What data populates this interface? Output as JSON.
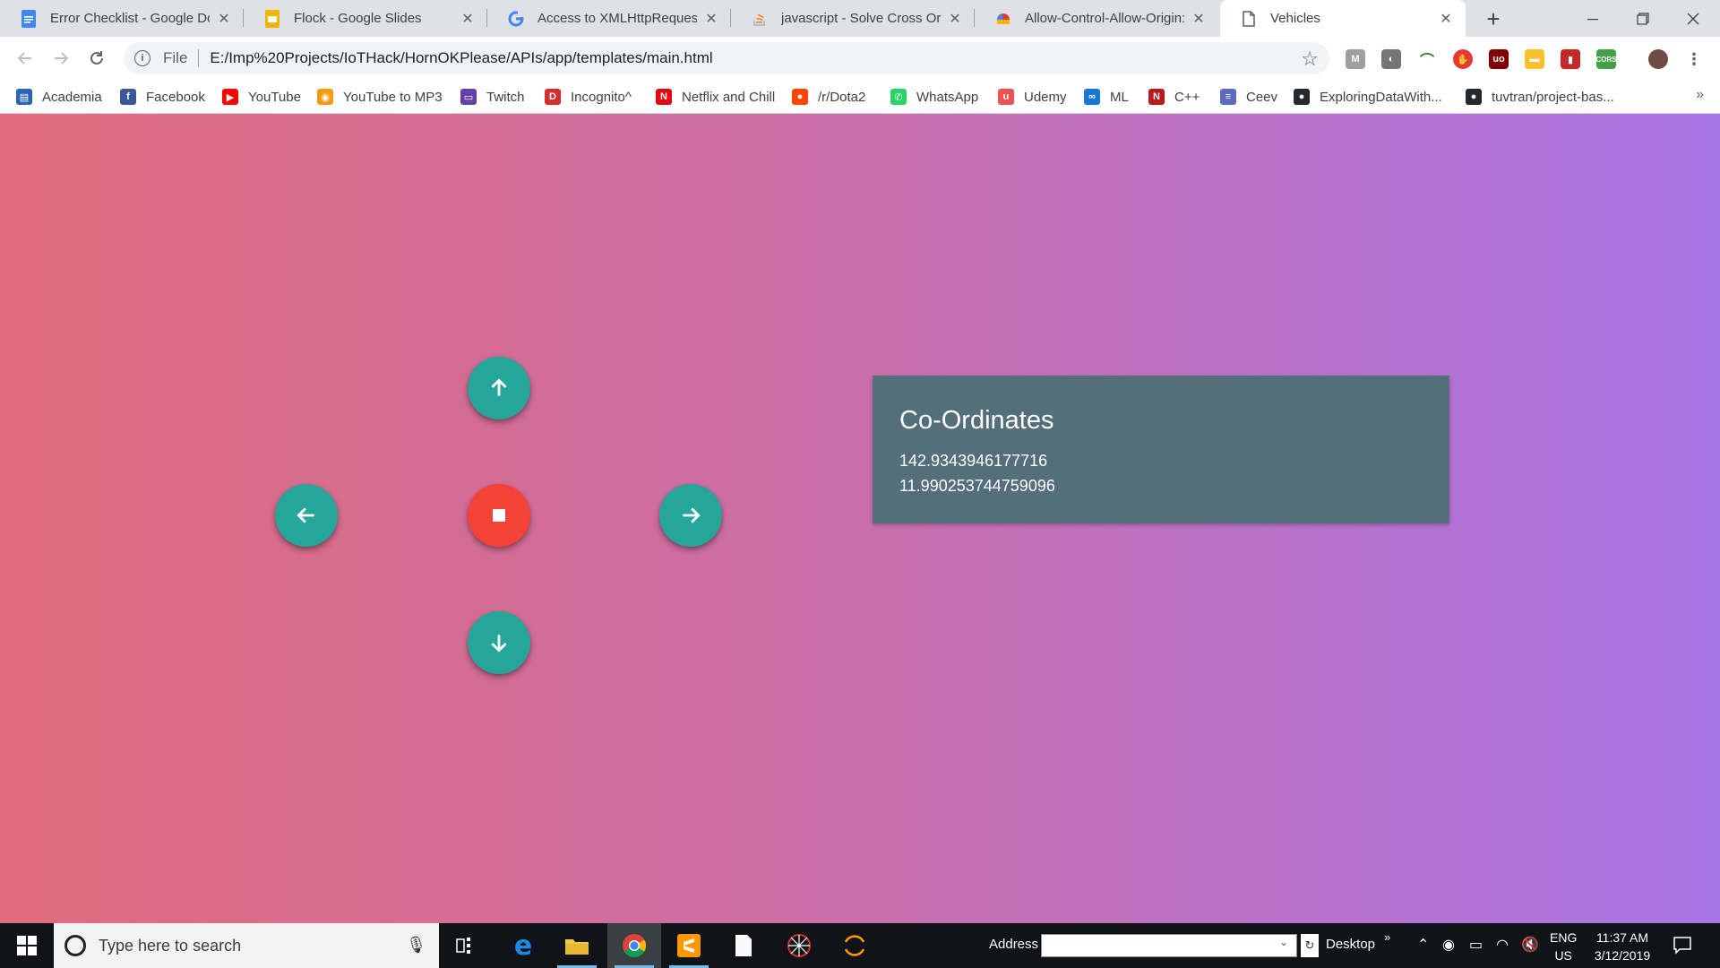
{
  "browser": {
    "tabs": [
      {
        "title": "Error Checklist - Google Docs",
        "icon": "google-docs-icon",
        "color": "#4285f4",
        "active": false
      },
      {
        "title": "Flock - Google Slides",
        "icon": "google-slides-icon",
        "color": "#f4b400",
        "active": false
      },
      {
        "title": "Access to XMLHttpRequest at",
        "icon": "google-icon",
        "color": "#4285f4",
        "active": false
      },
      {
        "title": "javascript - Solve Cross Origin",
        "icon": "stackoverflow-icon",
        "color": "#f48024",
        "active": false
      },
      {
        "title": "Allow-Control-Allow-Origin:",
        "icon": "chrome-webstore-icon",
        "color": "#e34133",
        "active": false
      },
      {
        "title": "Vehicles",
        "icon": "page-icon",
        "color": "#5f6368",
        "active": true
      }
    ],
    "new_tab_label": "+",
    "scheme_label": "File",
    "url": "E:/Imp%20Projects/IoTHack/HornOKPlease/APIs/app/templates/main.html",
    "bookmarks": [
      {
        "label": "Academia",
        "icon": "academia-icon",
        "color": "#2b63b5",
        "glyph": "▤"
      },
      {
        "label": "Facebook",
        "icon": "facebook-icon",
        "color": "#3b5998",
        "glyph": "f"
      },
      {
        "label": "YouTube",
        "icon": "youtube-icon",
        "color": "#ff0000",
        "glyph": "▶"
      },
      {
        "label": "YouTube to MP3",
        "icon": "ytmp3-icon",
        "color": "#f39c12",
        "glyph": "◉"
      },
      {
        "label": "Twitch",
        "icon": "twitch-icon",
        "color": "#6441a5",
        "glyph": "▭"
      },
      {
        "label": "Incognito^",
        "icon": "incognito-icon",
        "color": "#d32f2f",
        "glyph": "D"
      },
      {
        "label": "Netflix and Chill",
        "icon": "netflix-icon",
        "color": "#e50914",
        "glyph": "N"
      },
      {
        "label": "/r/Dota2",
        "icon": "reddit-icon",
        "color": "#ff4500",
        "glyph": "●"
      },
      {
        "label": "WhatsApp",
        "icon": "whatsapp-icon",
        "color": "#25d366",
        "glyph": "✆"
      },
      {
        "label": "Udemy",
        "icon": "udemy-icon",
        "color": "#ec5252",
        "glyph": "u"
      },
      {
        "label": "ML",
        "icon": "infinity-icon",
        "color": "#1976d2",
        "glyph": "∞"
      },
      {
        "label": "C++",
        "icon": "notion-icon",
        "color": "#b71c1c",
        "glyph": "N"
      },
      {
        "label": "Ceev",
        "icon": "ceev-icon",
        "color": "#5c6bc0",
        "glyph": "≡"
      },
      {
        "label": "ExploringDataWith...",
        "icon": "github-icon",
        "color": "#24292e",
        "glyph": "●"
      },
      {
        "label": "tuvtran/project-bas...",
        "icon": "github-icon",
        "color": "#24292e",
        "glyph": "●"
      }
    ],
    "bookmarks_more": "»"
  },
  "page": {
    "controls": {
      "up": "arrow-up",
      "left": "arrow-left",
      "stop": "stop",
      "right": "arrow-right",
      "down": "arrow-down"
    },
    "card": {
      "title": "Co-Ordinates",
      "values": [
        "142.9343946177716",
        "11.990253744759096"
      ]
    },
    "colors": {
      "gradient_start": "#e16c7c",
      "gradient_end": "#a874e4",
      "fab_teal": "#26a69a",
      "fab_red": "#f44336",
      "card_bg": "#546e7a"
    }
  },
  "taskbar": {
    "search_placeholder": "Type here to search",
    "address_label": "Address",
    "desktop_label": "Desktop",
    "lang_line1": "ENG",
    "lang_line2": "US",
    "time": "11:37 AM",
    "date": "3/12/2019"
  }
}
